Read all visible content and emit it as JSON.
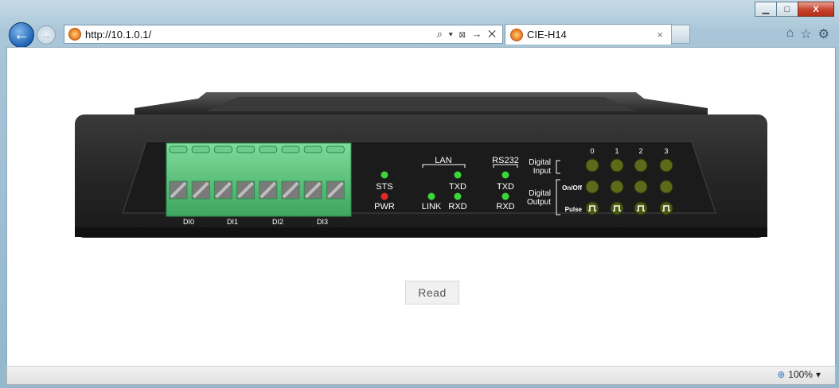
{
  "browser": {
    "url": "http://10.1.0.1/",
    "address_tools": "⌕ ▾ ⊠ → ✕",
    "tab_title": "CIE-H14",
    "tab_close": "×",
    "window_controls": {
      "minimize": "▁",
      "maximize": "□",
      "close": "X"
    },
    "right_tools": [
      "home-icon",
      "star-icon",
      "gear-icon"
    ],
    "zoom_level": "100%"
  },
  "device": {
    "terminal_labels": [
      "DI0",
      "DI1",
      "DI2",
      "DI3"
    ],
    "status_leds": {
      "sts": "STS",
      "pwr": "PWR"
    },
    "lan": {
      "title": "LAN",
      "txd": "TXD",
      "link": "LINK",
      "rxd": "RXD"
    },
    "rs232": {
      "title": "RS232",
      "txd": "TXD",
      "rxd": "RXD"
    },
    "digital_input_label_1": "Digital",
    "digital_input_label_2": "Input",
    "digital_output_label_1": "Digital",
    "digital_output_label_2": "Output",
    "onoff_label": "On/Off",
    "pulse_label": "Pulse",
    "channel_numbers": [
      "0",
      "1",
      "2",
      "3"
    ],
    "colors": {
      "led_green": "#3bd43b",
      "led_red": "#e02a2a",
      "led_off": "#5b6b1a",
      "terminal": "#4fbf74",
      "body": "#2b2b2b"
    }
  },
  "read_button": "Read"
}
